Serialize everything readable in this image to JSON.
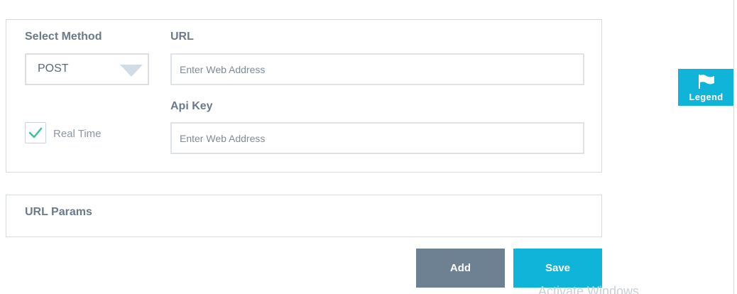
{
  "request": {
    "method_label": "Select Method",
    "method_value": "POST",
    "url_label": "URL",
    "url_placeholder": "Enter Web Address",
    "api_key_label": "Api Key",
    "api_key_placeholder": "Enter Web Address",
    "realtime_label": "Real Time",
    "realtime_checked": true
  },
  "params": {
    "title": "URL Params"
  },
  "actions": {
    "add_label": "Add",
    "save_label": "Save"
  },
  "legend": {
    "label": "Legend",
    "icon": "flag-icon"
  },
  "watermark": "Activate Windows",
  "colors": {
    "accent": "#10b4d8",
    "secondary_button": "#6e8193",
    "check": "#3fbf9a"
  }
}
